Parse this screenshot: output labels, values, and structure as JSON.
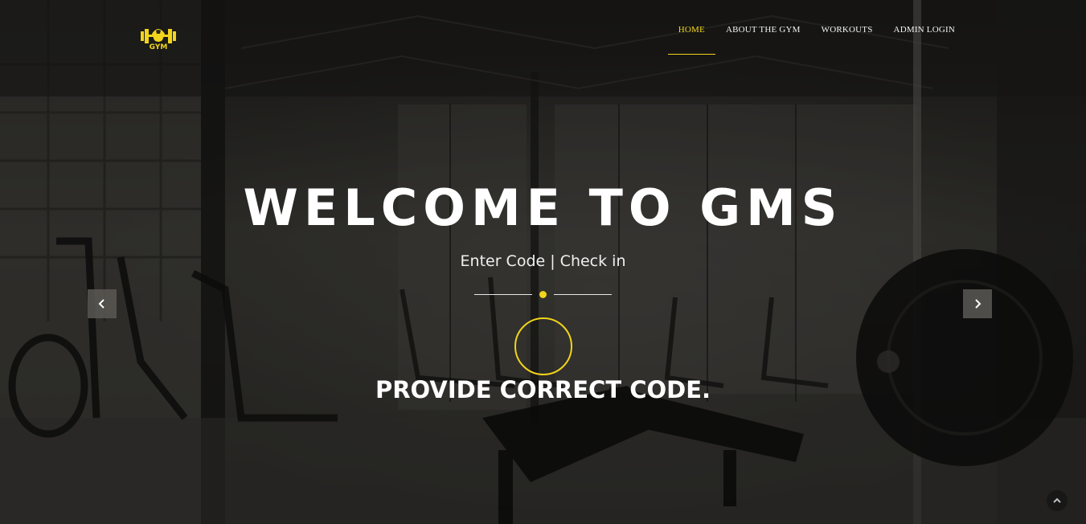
{
  "header": {
    "logo_text": "GYM",
    "nav": [
      {
        "label": "HOME",
        "active": true
      },
      {
        "label": "ABOUT THE GYM",
        "active": false
      },
      {
        "label": "WORKOUTS",
        "active": false
      },
      {
        "label": "ADMIN LOGIN",
        "active": false
      }
    ]
  },
  "hero": {
    "title": "WELCOME TO GMS",
    "subtitle": "Enter Code | Check in",
    "message": "PROVIDE CORRECT CODE.",
    "icons": {
      "prev": "chevron-left-icon",
      "next": "chevron-right-icon",
      "to_top": "chevron-up-icon"
    }
  },
  "colors": {
    "accent": "#f1d41c",
    "text": "#ffffff",
    "overlay": "#2a2926"
  }
}
